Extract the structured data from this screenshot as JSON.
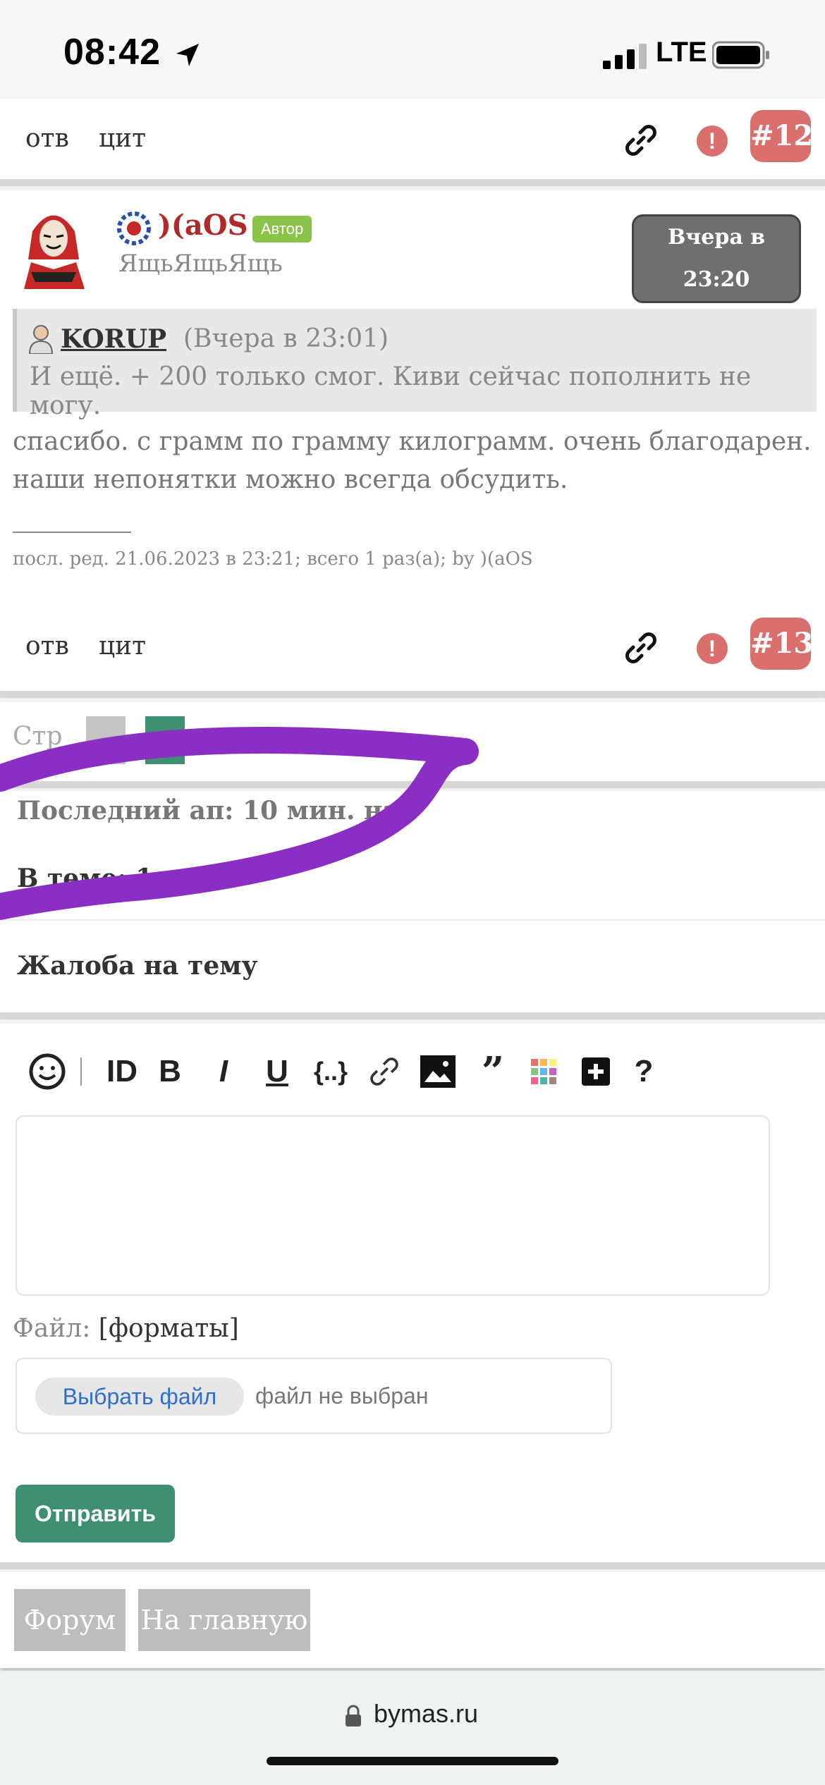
{
  "status_bar": {
    "time": "08:42",
    "network": "LTE",
    "location_icon": "location-arrow-icon",
    "signal_icon": "cell-signal-icon",
    "battery_icon": "battery-icon"
  },
  "post12": {
    "reply_label": "отв",
    "quote_label": "цит",
    "number": "#12",
    "link_icon": "link-icon",
    "report_icon": "alert-icon"
  },
  "post13": {
    "username": ")(aOS",
    "author_badge": "Автор",
    "user_title": "ЯщьЯщьЯщь",
    "date": "Вчера в 23:20",
    "quote": {
      "author": "KORUP",
      "date": "(Вчера в 23:01)",
      "text": "И ещё. + 200 только смог. Киви сейчас пополнить не могу."
    },
    "text_line1": "спасибо. с грамм по грамму килограмм. очень благодарен.",
    "text_line2": "наши непонятки можно всегда обсудить.",
    "edit_note": "посл. ред. 21.06.2023 в 23:21; всего 1 раз(а); by )(aOS",
    "reply_label": "отв",
    "quote_label": "цит",
    "number": "#13"
  },
  "pages": {
    "label": "Стр"
  },
  "topic_info": {
    "last_update": "Последний ап: 10 мин. наз",
    "in_topic": "В теме: 1",
    "complaint": "Жалоба на тему"
  },
  "editor": {
    "toolbar": [
      "smile-icon",
      "id-icon",
      "bold-icon",
      "italic-icon",
      "underline-icon",
      "code-icon",
      "link-icon",
      "image-icon",
      "quote-icon",
      "color-icon",
      "plus-icon",
      "help-icon"
    ],
    "file_label": "Файл:",
    "file_formats": "[форматы]",
    "choose_file": "Выбрать файл",
    "no_file": "файл не выбран",
    "submit": "Отправить"
  },
  "nav": {
    "forum": "Форум",
    "home": "На главную"
  },
  "browser": {
    "url": "bymas.ru"
  },
  "colors": {
    "post_number": "#d9706e",
    "submit": "#3f8f72",
    "username": "#b02a2a",
    "author_badge": "#8bc34a",
    "scribble": "#8b2fc4"
  }
}
